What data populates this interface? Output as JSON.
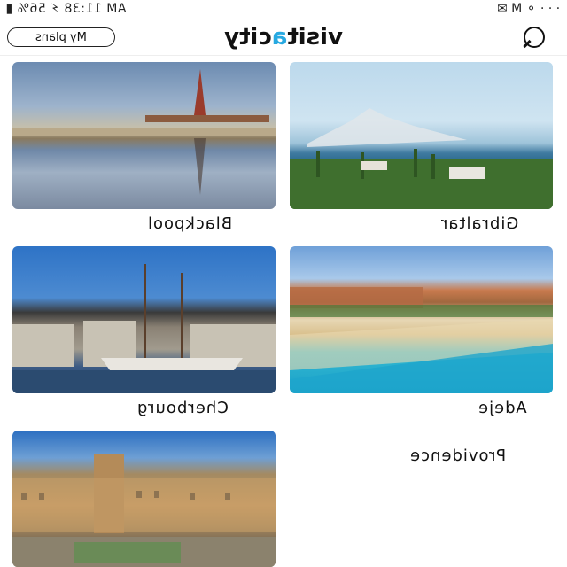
{
  "status_bar": {
    "left_text": "AM 11:38 ⚡ 56% ▮",
    "right_text": "· · ·  ⚬ M ✉"
  },
  "header": {
    "logo_part1": "visit",
    "logo_accent": "a",
    "logo_part2": "city",
    "accent_color": "#27a9e1",
    "myplans_label": "My plans"
  },
  "cities": [
    {
      "name": "Gibraltar"
    },
    {
      "name": "Blackpool"
    },
    {
      "name": "Adeje"
    },
    {
      "name": "Cherbourg"
    },
    {
      "name": "Providence"
    }
  ]
}
